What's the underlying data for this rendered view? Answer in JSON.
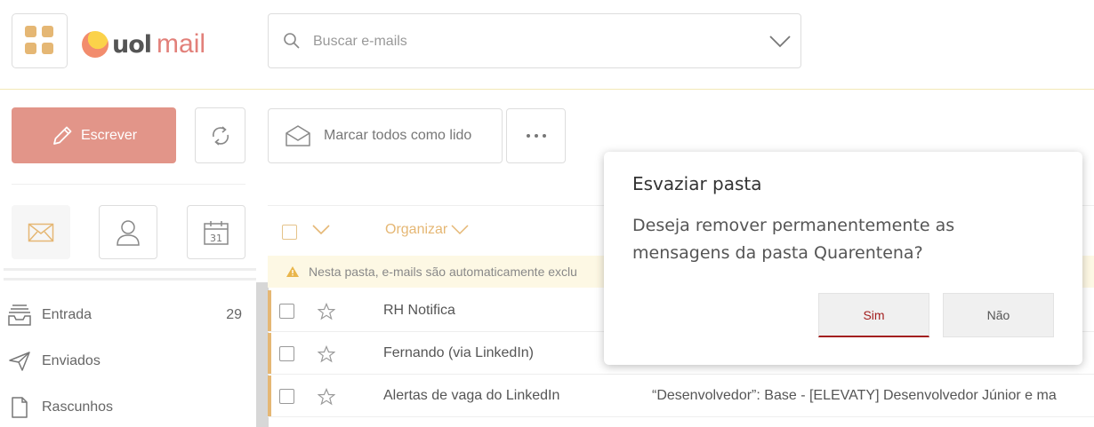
{
  "header": {
    "logo_uol": "uol",
    "logo_mail": "mail",
    "search_placeholder": "Buscar e-mails",
    "colors": {
      "accent": "#e5b774",
      "brand": "#e2807a"
    }
  },
  "toolbar": {
    "compose_label": "Escrever",
    "mark_read_label": "Marcar todos como lido",
    "compose_color": "#e29589"
  },
  "sidebar": {
    "tabs": [
      {
        "icon": "envelope-icon"
      },
      {
        "icon": "user-icon"
      },
      {
        "icon": "calendar-icon",
        "day": "31"
      }
    ],
    "folders": [
      {
        "label": "Entrada",
        "count": "29",
        "icon": "inbox-icon"
      },
      {
        "label": "Enviados",
        "count": "",
        "icon": "send-icon"
      },
      {
        "label": "Rascunhos",
        "count": "",
        "icon": "file-icon"
      }
    ]
  },
  "list": {
    "sort_label": "Organizar",
    "notice": "Nesta pasta, e-mails são automaticamente exclu",
    "rows": [
      {
        "sender": "RH Notifica",
        "subject": ""
      },
      {
        "sender": "Fernando (via LinkedIn)",
        "subject": ""
      },
      {
        "sender": "Alertas de vaga do LinkedIn",
        "subject": "“Desenvolvedor”: Base - [ELEVATY] Desenvolvedor Júnior e ma"
      }
    ]
  },
  "dialog": {
    "title": "Esvaziar pasta",
    "message": "Deseja remover permanentemente as mensagens da pasta Quarentena?",
    "yes_label": "Sim",
    "no_label": "Não",
    "yes_color": "#a31f1f"
  }
}
